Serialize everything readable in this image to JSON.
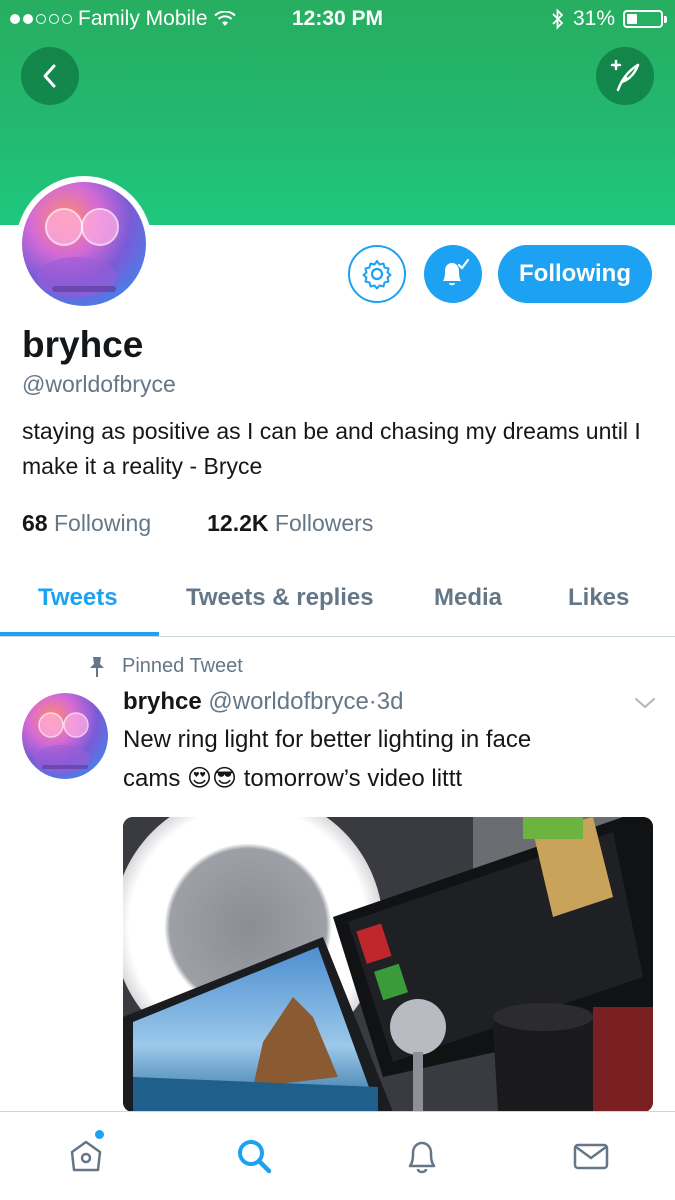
{
  "status_bar": {
    "carrier": "Family Mobile",
    "time": "12:30 PM",
    "battery": "31%",
    "battery_level": 0.31
  },
  "header": {
    "back_icon": "chevron-left-icon",
    "compose_icon": "compose-tweet-icon",
    "banner_color": "#22b86f"
  },
  "profile": {
    "name": "bryhce",
    "handle": "@worldofbryce",
    "bio": "staying as positive as I can be and chasing my dreams until I make it a reality - Bryce",
    "following_count": "68",
    "following_label": "Following",
    "followers_count": "12.2K",
    "followers_label": "Followers",
    "follow_button_label": "Following",
    "accent_color": "#1da1f2"
  },
  "tabs": [
    {
      "label": "Tweets",
      "active": true
    },
    {
      "label": "Tweets & replies",
      "active": false
    },
    {
      "label": "Media",
      "active": false
    },
    {
      "label": "Likes",
      "active": false
    }
  ],
  "pinned_tweet": {
    "pinned_label": "Pinned Tweet",
    "author_name": "bryhce",
    "author_handle": "@worldofbryce",
    "separator": "·",
    "age": "3d",
    "text_line1": "New ring light for better lighting in face",
    "text_line2_start": "cams",
    "text_line2_end": "tomorrow’s video littt",
    "emoji1": "😍",
    "emoji2": "😎"
  },
  "bottom_bar": {
    "items": [
      "home-icon",
      "search-icon",
      "notifications-icon",
      "messages-icon"
    ],
    "active": "search-icon"
  }
}
